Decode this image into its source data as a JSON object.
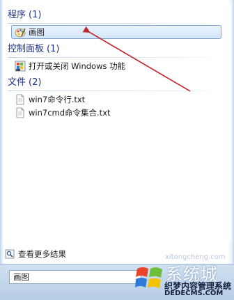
{
  "groups": [
    {
      "name": "程序",
      "count": "(1)",
      "items": [
        {
          "label": "画图",
          "icon": "paint-icon"
        }
      ]
    },
    {
      "name": "控制面板",
      "count": "(1)",
      "items": [
        {
          "label": "打开或关闭 Windows 功能",
          "icon": "windows-features-icon"
        }
      ]
    },
    {
      "name": "文件",
      "count": "(2)",
      "items": [
        {
          "label": "win7命令行.txt",
          "icon": "text-file-icon"
        },
        {
          "label": "win7cmd命令集合.txt",
          "icon": "text-file-icon"
        }
      ]
    }
  ],
  "see_more": {
    "label": "查看更多结果",
    "icon": "search-icon"
  },
  "search": {
    "value": "画图"
  },
  "watermark": {
    "title": "系统城",
    "site_name": "织梦内容管理系统",
    "url": "DEDECMS.COM",
    "faint": "xitongcheng.com"
  },
  "colors": {
    "header_text": "#1e3287",
    "arrow": "#c0282d",
    "selection_border": "#7da2ce"
  }
}
